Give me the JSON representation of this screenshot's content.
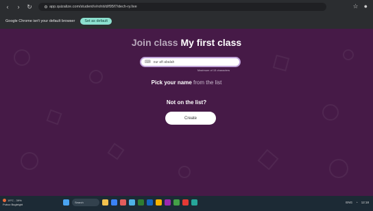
{
  "browser": {
    "url": "app.quizalize.com/student/v/rohit/d/f95f7/dech-ry.live",
    "icons": [
      "back-icon",
      "forward-icon",
      "reload-icon",
      "site-info-icon",
      "extension-icon",
      "profile-icon"
    ]
  },
  "notice": {
    "text": "Google Chrome isn't your default browser",
    "button": "Set as default"
  },
  "page": {
    "title_prefix": "Join class",
    "title_main": "My first class",
    "input_value": "our aft abalah",
    "max_note": "Maximum of 15 characters",
    "pick_bold": "Pick your name",
    "pick_rest": " from the list",
    "not_on_list": "Not on the list?",
    "create_button": "Create",
    "colors": {
      "background": "#461a47",
      "input_border": "#bfa3d9"
    }
  },
  "taskbar": {
    "weather_temp": "19°C - 39%",
    "weather_desc": "Puboz Bugleight",
    "search_placeholder": "Search",
    "tray_lang": "ENG",
    "time": "12:18"
  }
}
